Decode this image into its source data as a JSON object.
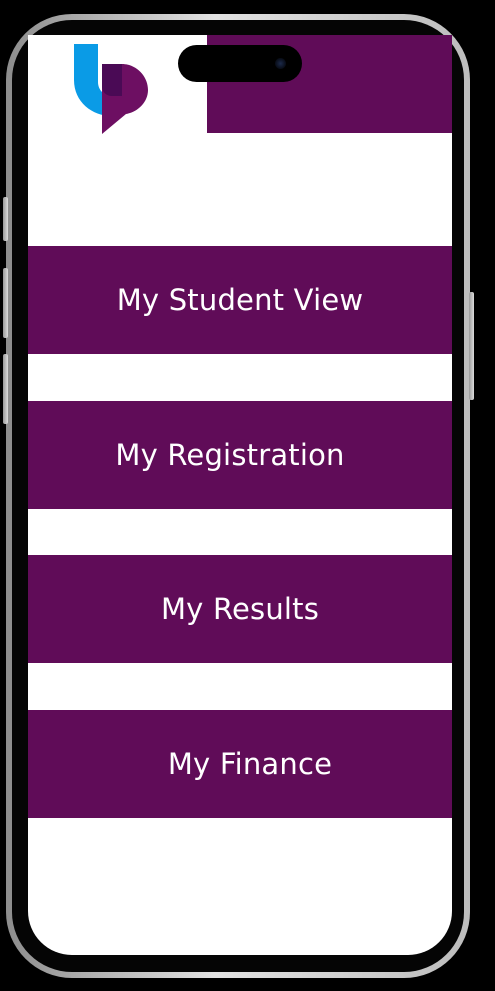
{
  "theme": {
    "primary": "#600c58",
    "screen_bg": "#ffffff",
    "logo_blue": "#0a9be6",
    "logo_purple": "#6d0f62"
  },
  "logo": {
    "icon": "university-logo-icon"
  },
  "menu": {
    "items": [
      {
        "label": "My Student View"
      },
      {
        "label": "My Registration"
      },
      {
        "label": "My Results"
      },
      {
        "label": "My Finance"
      }
    ]
  }
}
